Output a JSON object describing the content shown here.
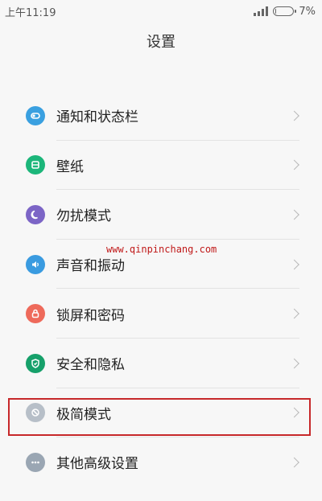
{
  "status_bar": {
    "time": "上午11:19",
    "battery_percent_text": "7%",
    "battery_level": 0.07,
    "signal_level": 4
  },
  "title": "设置",
  "watermark": "www.qinpinchang.com",
  "rows": [
    {
      "label": "通知和状态栏",
      "icon": "notification-icon",
      "color": "#3aa0e0"
    },
    {
      "label": "壁纸",
      "icon": "wallpaper-icon",
      "color": "#1cb67a"
    },
    {
      "label": "勿扰模式",
      "icon": "moon-icon",
      "color": "#7c65c6"
    },
    {
      "label": "声音和振动",
      "icon": "speaker-icon",
      "color": "#3a9be0"
    },
    {
      "label": "锁屏和密码",
      "icon": "lock-icon",
      "color": "#ee6a5b"
    },
    {
      "label": "安全和隐私",
      "icon": "shield-icon",
      "color": "#16a06a"
    },
    {
      "label": "极简模式",
      "icon": "minimal-mode-icon",
      "color": "#b7bfc8"
    },
    {
      "label": "其他高级设置",
      "icon": "more-icon",
      "color": "#9aa6b3"
    }
  ],
  "highlight_color": "#c7282a"
}
